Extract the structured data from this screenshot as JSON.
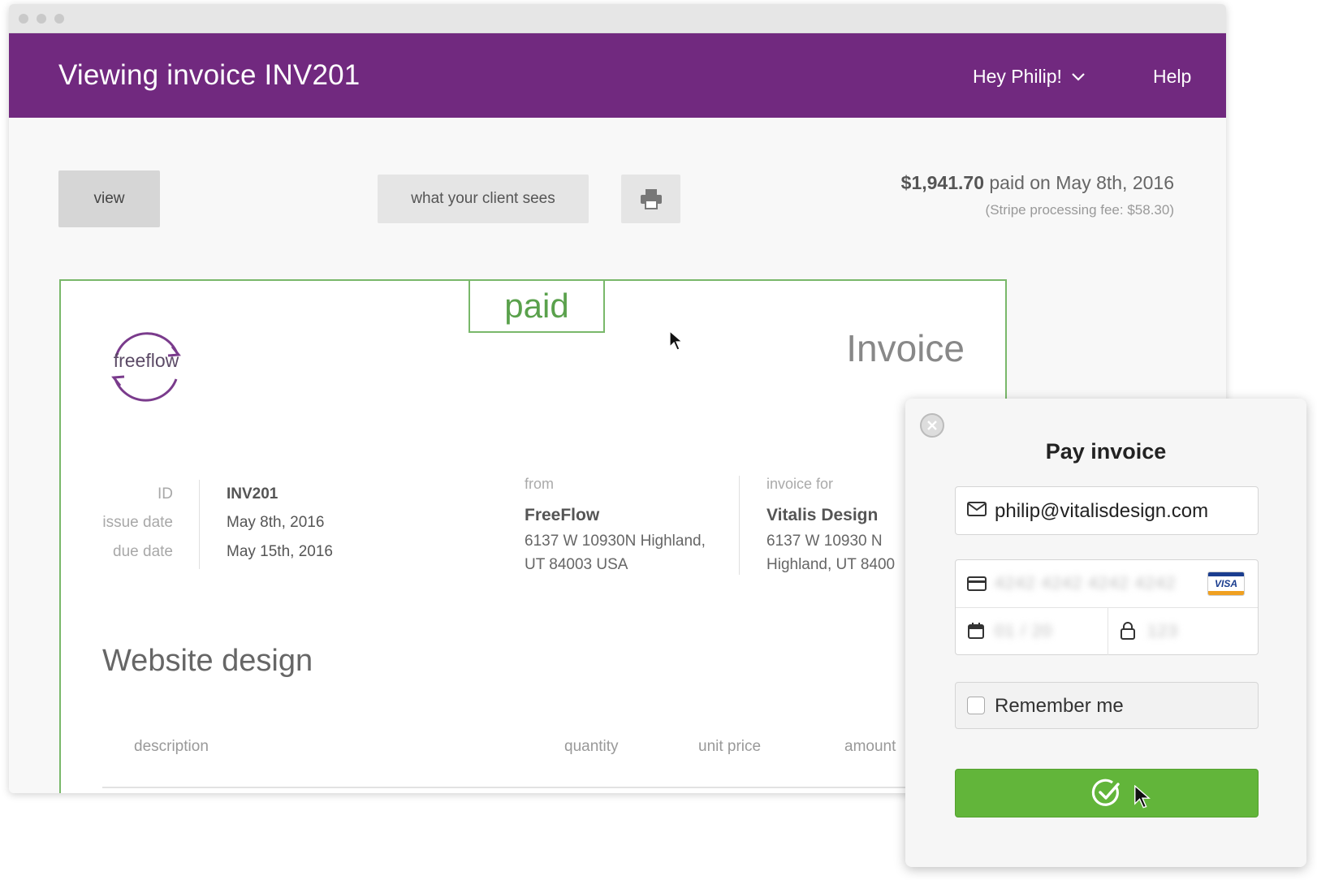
{
  "header": {
    "title": "Viewing invoice INV201",
    "user_menu": "Hey Philip!",
    "help": "Help"
  },
  "toolbar": {
    "view": "view",
    "client_sees": "what your client sees",
    "print_icon": "printer-icon"
  },
  "payment": {
    "amount": "$1,941.70",
    "paid_text": "paid on May 8th, 2016",
    "fee": "(Stripe processing fee: $58.30)"
  },
  "invoice": {
    "status": "paid",
    "logo_text": "freeflow",
    "label": "Invoice",
    "meta": {
      "id_label": "ID",
      "id_value": "INV201",
      "issue_label": "issue date",
      "issue_value": "May 8th, 2016",
      "due_label": "due date",
      "due_value": "May 15th, 2016"
    },
    "from": {
      "head": "from",
      "name": "FreeFlow",
      "addr1": "6137 W 10930N Highland,",
      "addr2": "UT 84003 USA"
    },
    "for": {
      "head": "invoice for",
      "name": "Vitalis Design",
      "addr1": "6137 W 10930 N",
      "addr2": "Highland, UT 8400"
    },
    "section": "Website design",
    "columns": [
      "description",
      "quantity",
      "unit price",
      "amount"
    ]
  },
  "modal": {
    "title": "Pay invoice",
    "email": "philip@vitalisdesign.com",
    "card_number": "4242 4242 4242 4242",
    "expiry": "01 / 20",
    "cvc": "123",
    "card_brand": "VISA",
    "remember": "Remember me",
    "pay_icon": "check-circle-icon"
  },
  "colors": {
    "header": "#71297f",
    "paid_green": "#5aa14c",
    "pay_button": "#62b53a"
  }
}
